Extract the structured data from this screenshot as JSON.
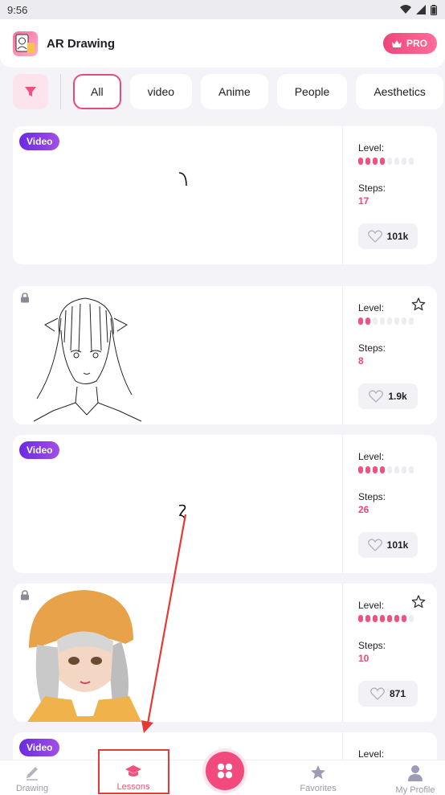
{
  "status": {
    "time": "9:56"
  },
  "header": {
    "title": "AR Drawing",
    "pro_label": "PRO"
  },
  "filters": [
    "All",
    "video",
    "Anime",
    "People",
    "Aesthetics"
  ],
  "cards": [
    {
      "badge": "Video",
      "level_label": "Level:",
      "level": 4,
      "level_max": 8,
      "steps_label": "Steps:",
      "steps": "17",
      "likes": "101k"
    },
    {
      "badge": "",
      "level_label": "Level:",
      "level": 2,
      "level_max": 8,
      "steps_label": "Steps:",
      "steps": "8",
      "likes": "1.9k"
    },
    {
      "badge": "Video",
      "level_label": "Level:",
      "level": 4,
      "level_max": 8,
      "steps_label": "Steps:",
      "steps": "26",
      "likes": "101k"
    },
    {
      "badge": "",
      "level_label": "Level:",
      "level": 7,
      "level_max": 8,
      "steps_label": "Steps:",
      "steps": "10",
      "likes": "871"
    },
    {
      "badge": "Video",
      "level_label": "Level:"
    }
  ],
  "nav": {
    "drawing": "Drawing",
    "lessons": "Lessons",
    "favorites": "Favorites",
    "profile": "My Profile"
  },
  "colors": {
    "accent": "#f0517d",
    "video_badge": "#7b33e3",
    "annotation": "#e53935"
  }
}
